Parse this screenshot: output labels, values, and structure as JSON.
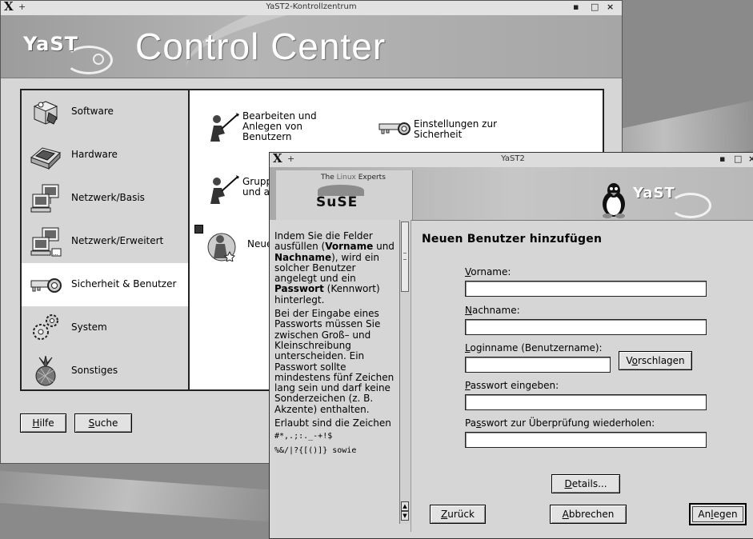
{
  "main_window": {
    "title": "YaST2-Kontrollzentrum",
    "banner_title": "Control Center",
    "logo_text": "YaST",
    "categories": [
      {
        "label": "Software",
        "icon": "software-package-icon"
      },
      {
        "label": "Hardware",
        "icon": "hardware-scanner-icon"
      },
      {
        "label": "Netzwerk/Basis",
        "icon": "network-computer-icon"
      },
      {
        "label": "Netzwerk/Erweitert",
        "icon": "network-advanced-icon"
      },
      {
        "label": "Sicherheit & Benutzer",
        "icon": "key-icon"
      },
      {
        "label": "System",
        "icon": "gears-icon"
      },
      {
        "label": "Sonstiges",
        "icon": "pineapple-icon"
      }
    ],
    "modules": [
      {
        "label": "Bearbeiten und\nAnlegen von\nBenutzern",
        "icon": "user-edit-icon"
      },
      {
        "label": "Einstellungen zur\nSicherheit",
        "icon": "key-icon"
      },
      {
        "label": "Grupp\nund a",
        "icon": "group-edit-icon"
      },
      {
        "label": "Neue",
        "icon": "new-user-icon"
      }
    ],
    "buttons": {
      "help_prefix": "",
      "help_u": "H",
      "help_rest": "ilfe",
      "search_u": "S",
      "search_rest": "uche"
    }
  },
  "dialog": {
    "title": "YaST2",
    "suse_tag_a": "The ",
    "suse_tag_b": "Linux",
    "suse_tag_c": " Experts",
    "suse_logo": "SuSE",
    "yast_logo": "YaST",
    "help_paragraphs": [
      {
        "parts": [
          "Indem Sie die Felder ausfüllen (",
          "Vorname",
          " und ",
          "Nachname",
          "), wird ein solcher Benutzer angelegt und ein ",
          "Passwort",
          " (Kennwort) hinterlegt."
        ]
      },
      {
        "parts": [
          "Bei der Eingabe eines Passworts müssen Sie zwischen Groß– und Kleinschreibung unterscheiden. Ein Passwort sollte mindestens fünf Zeichen lang sein und darf keine Sonderzeichen (z. B. Akzente) enthalten."
        ]
      },
      {
        "parts": [
          "Erlaubt sind die Zeichen"
        ]
      }
    ],
    "help_chars_1": "#*,.;:._-+!$",
    "help_chars_2": "%&/|?{[()]} sowie",
    "form_title": "Neuen Benutzer hinzufügen",
    "fields": [
      {
        "u": "V",
        "rest": "orname:",
        "value": ""
      },
      {
        "u": "N",
        "rest": "achname:",
        "value": ""
      },
      {
        "u": "L",
        "rest": "oginname (Benutzername):",
        "value": ""
      },
      {
        "u": "P",
        "rest": "asswort eingeben:",
        "value": ""
      },
      {
        "pre": "Pa",
        "u": "s",
        "rest": "swort zur Überprüfung wiederholen:",
        "value": ""
      }
    ],
    "suggest_button": {
      "pre": "V",
      "u": "o",
      "rest": "rschlagen"
    },
    "details_button": {
      "u": "D",
      "rest": "etails..."
    },
    "back_button": {
      "u": "Z",
      "rest": "urück"
    },
    "abort_button": {
      "u": "A",
      "rest": "bbrechen"
    },
    "create_button": {
      "pre": "An",
      "u": "l",
      "rest": "egen"
    }
  }
}
